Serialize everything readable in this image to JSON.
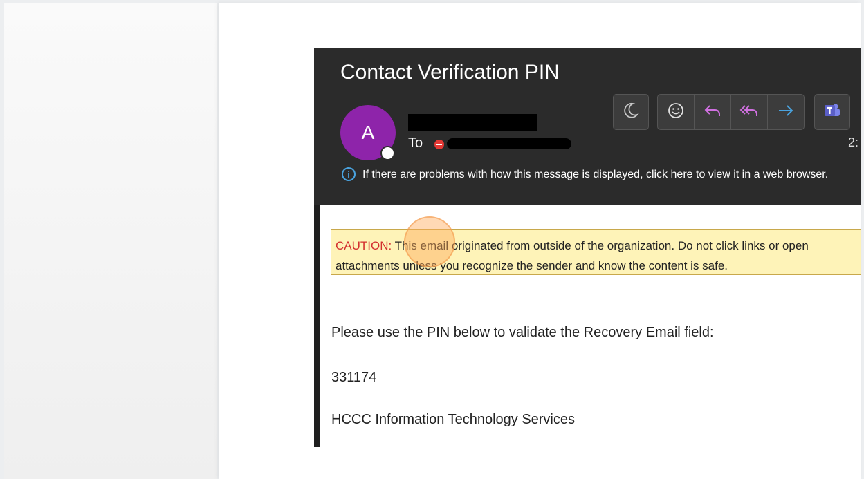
{
  "email": {
    "subject": "Contact Verification PIN",
    "avatar_initial": "A",
    "to_label": "To",
    "time_partial": "2:",
    "info_message": "If there are problems with how this message is displayed, click here to view it in a web browser.",
    "caution_label": "CAUTION:",
    "caution_text": " This email originated from outside of the organization. Do not click links or open attachments unless you recognize the sender and know the content is safe.",
    "body_line_1": "Please use the PIN below to validate the Recovery Email field:",
    "pin": "331174",
    "signature": "HCCC Information Technology Services"
  },
  "toolbar_icons": [
    "moon-icon",
    "emoji-icon",
    "reply-icon",
    "reply-all-icon",
    "forward-icon",
    "teams-icon"
  ],
  "colors": {
    "header_bg": "#2b2b2b",
    "avatar": "#8e24aa",
    "caution_bg": "#fef3b8",
    "caution_label": "#d32f2f",
    "reply_icon": "#d070e0",
    "forward_icon": "#4aa3df",
    "teams": "#5b5fc7"
  }
}
